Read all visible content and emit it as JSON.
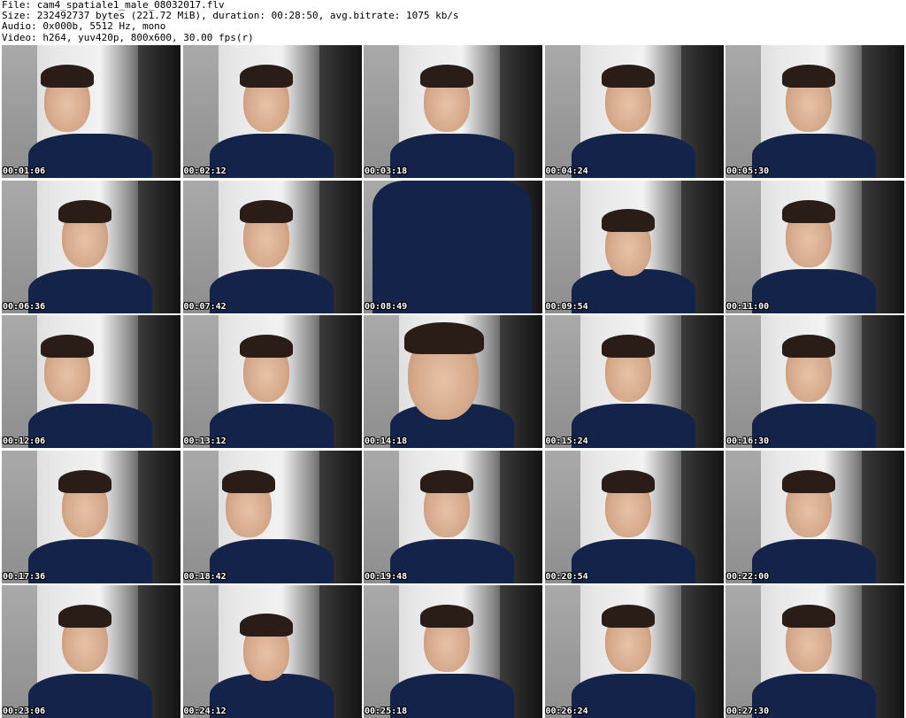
{
  "header": {
    "file": "File: cam4_spatiale1_male_08032017.flv",
    "size": "Size: 232492737 bytes (221.72 MiB), duration: 00:28:50, avg.bitrate: 1075 kb/s",
    "audio": "Audio: 0x000b, 5512 Hz, mono",
    "video": "Video: h264, yuv420p, 800x600, 30.00 fps(r)"
  },
  "thumbnails": [
    {
      "timestamp": "00:01:06"
    },
    {
      "timestamp": "00:02:12"
    },
    {
      "timestamp": "00:03:18"
    },
    {
      "timestamp": "00:04:24"
    },
    {
      "timestamp": "00:05:30"
    },
    {
      "timestamp": "00:06:36"
    },
    {
      "timestamp": "00:07:42"
    },
    {
      "timestamp": "00:08:49"
    },
    {
      "timestamp": "00:09:54"
    },
    {
      "timestamp": "00:11:00"
    },
    {
      "timestamp": "00:12:06"
    },
    {
      "timestamp": "00:13:12"
    },
    {
      "timestamp": "00:14:18"
    },
    {
      "timestamp": "00:15:24"
    },
    {
      "timestamp": "00:16:30"
    },
    {
      "timestamp": "00:17:36"
    },
    {
      "timestamp": "00:18:42"
    },
    {
      "timestamp": "00:19:48"
    },
    {
      "timestamp": "00:20:54"
    },
    {
      "timestamp": "00:22:00"
    },
    {
      "timestamp": "00:23:06"
    },
    {
      "timestamp": "00:24:12"
    },
    {
      "timestamp": "00:25:18"
    },
    {
      "timestamp": "00:26:24"
    },
    {
      "timestamp": "00:27:30"
    }
  ],
  "colors": {
    "background": "#ffffff",
    "timestamp_text": "#ffffff",
    "timestamp_outline": "#000000",
    "shirt": "#13234a"
  }
}
